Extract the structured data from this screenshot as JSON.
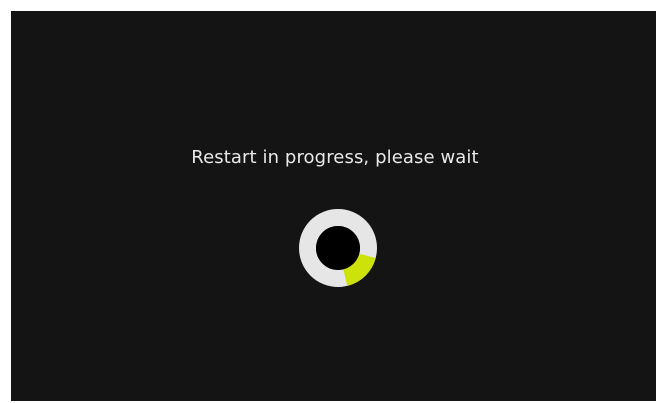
{
  "status": {
    "message": "Restart in progress, please wait",
    "progress": 0.17
  },
  "spinner": {
    "icon": "loading-spinner-icon",
    "track_color": "#e6e6e6",
    "arc_color": "#cde10a",
    "center_color": "#000000"
  },
  "colors": {
    "background": "#141414",
    "text": "#e9e9e9"
  }
}
